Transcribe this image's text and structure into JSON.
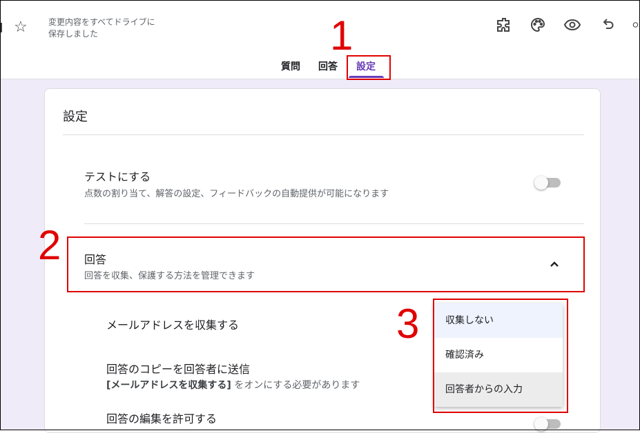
{
  "header": {
    "save_status": "変更内容をすべてドライブに\n保存しました",
    "tabs": [
      {
        "label": "質問"
      },
      {
        "label": "回答"
      },
      {
        "label": "設定"
      }
    ]
  },
  "settings": {
    "title": "設定",
    "quiz": {
      "title": "テストにする",
      "description": "点数の割り当て、解答の設定、フィードバックの自動提供が可能になります"
    },
    "responses": {
      "title": "回答",
      "description": "回答を収集、保護する方法を管理できます",
      "collect_email_label": "メールアドレスを収集する",
      "send_copy_title": "回答のコピーを回答者に送信",
      "send_copy_note_bold": "[メールアドレスを収集する]",
      "send_copy_note_rest": " をオンにする必要があります",
      "allow_edit_title": "回答の編集を許可する"
    },
    "email_menu": {
      "options": [
        "収集しない",
        "確認済み",
        "回答者からの入力"
      ]
    }
  },
  "annotations": {
    "labels": [
      "1",
      "2",
      "3"
    ],
    "color": "#e00000"
  },
  "colors": {
    "accent": "#673ab7",
    "page_background": "#f0ebf8"
  },
  "icons": [
    "star-icon",
    "add-on-icon",
    "palette-icon",
    "preview-eye-icon",
    "undo-icon",
    "chevron-up-icon"
  ]
}
